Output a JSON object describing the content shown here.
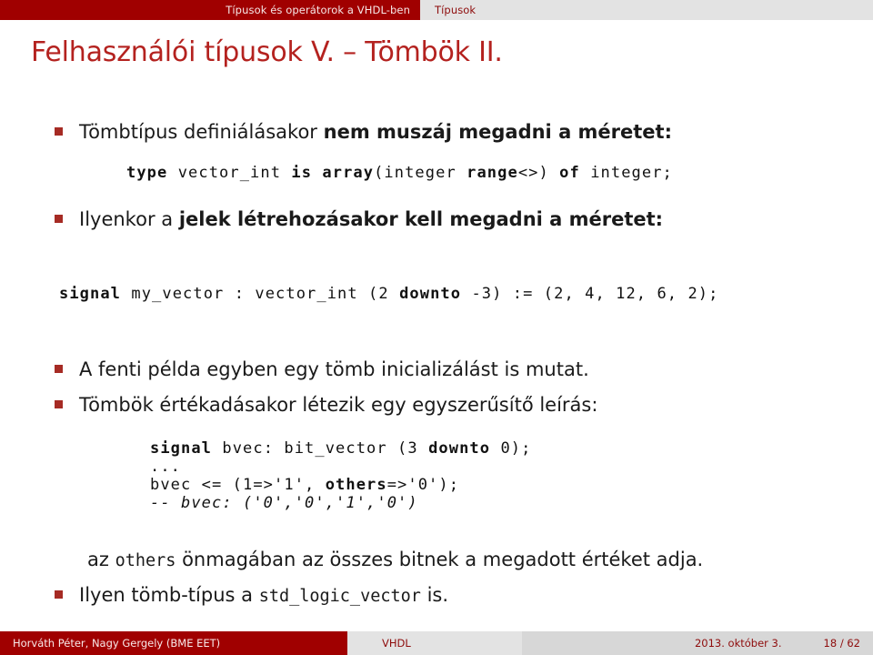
{
  "header": {
    "section": "Típusok és operátorok a VHDL-ben",
    "subsection": "Típusok"
  },
  "title": "Felhasználói típusok V. – Tömbök II.",
  "colors": {
    "brand_red": "#a00000",
    "title_red": "#b4221f",
    "bullet_red": "#a62b24",
    "header_bg": "#e3e3e3",
    "footer_meta_bg": "#d7d7d7"
  },
  "body": {
    "bullet1": {
      "lead": "Tömbtípus definiálásakor ",
      "strong": "nem muszáj megadni a méretet:"
    },
    "code1": {
      "kw_type": "type",
      "name": "vector_int",
      "kw_is": "is",
      "kw_array": "array",
      "open_integer": "(integer",
      "kw_range": "range",
      "mid": "<>)",
      "kw_of": "of",
      "tail": "integer;"
    },
    "bullet2": {
      "lead": "Ilyenkor a ",
      "strong": "jelek létrehozásakor kell megadni a méretet:"
    },
    "code2": {
      "kw_signal": "signal",
      "mid1": "my_vector : vector_int (2",
      "kw_downto": "downto",
      "tail": "-3) := (2, 4, 12, 6, 2);"
    },
    "bullet3": {
      "text": "A fenti példa egyben egy tömb inicializálást is mutat."
    },
    "bullet4": {
      "text": "Tömbök értékadásakor létezik egy egyszerűsítő leírás:"
    },
    "code3": {
      "line1_kw": "signal",
      "line1_rest": "bvec: bit_vector (3",
      "line1_kw2": "downto",
      "line1_tail": "0);",
      "line2": "...",
      "line3_head": "bvec <= (1=>'1',",
      "line3_kw": "others",
      "line3_tail": "=>'0');",
      "line4": "-- bvec: ('0','0','1','0')"
    },
    "note": {
      "lead": "az ",
      "mono": "others",
      "tail": " önmagában az összes bitnek a megadott értéket adja."
    },
    "bullet5": {
      "lead": "Ilyen tömb-típus a ",
      "mono": "std_logic_vector",
      "tail": " is."
    }
  },
  "footer": {
    "author": "Horváth Péter, Nagy Gergely  (BME EET)",
    "title": "VHDL",
    "date": "2013. október 3.",
    "page": "18 / 62"
  }
}
